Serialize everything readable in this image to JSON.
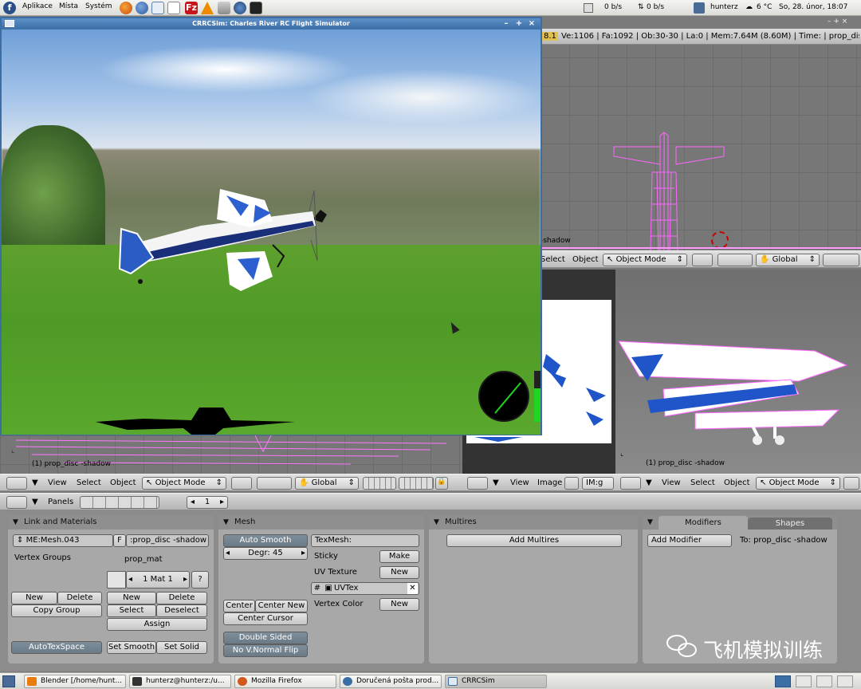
{
  "top_panel": {
    "menus": [
      "Aplikace",
      "Místa",
      "Systém"
    ],
    "net_down": "0 b/s",
    "net_up": "0 b/s",
    "user": "hunterz",
    "temperature": "6 °C",
    "clock": "So, 28. únor, 18:07"
  },
  "crrcsim": {
    "title": "CRRCSim: Charles River RC Flight Simulator",
    "wind_controls": [
      "–",
      "+",
      "×"
    ]
  },
  "viewport_top_right": {
    "version": "8.1",
    "stats": "Ve:1106 | Fa:1092 | Ob:30-30 | La:0  | Mem:7.64M (8.60M) | Time: | prop_disc",
    "label": "-shadow",
    "header": {
      "select": "Select",
      "object": "Object",
      "mode": "Object Mode",
      "orientation": "Global"
    }
  },
  "viewport_left": {
    "label": "(1) prop_disc -shadow",
    "header": {
      "view": "View",
      "select": "Select",
      "object": "Object",
      "mode": "Object Mode",
      "orientation": "Global"
    }
  },
  "image_editor": {
    "header": {
      "view": "View",
      "image": "Image",
      "field": "IM:g"
    }
  },
  "viewport_bottom_right": {
    "label": "(1) prop_disc -shadow",
    "header": {
      "view": "View",
      "select": "Select",
      "object": "Object",
      "mode": "Object Mode"
    }
  },
  "buttons_header": {
    "panels": "Panels",
    "frame": "1"
  },
  "link_materials": {
    "title": "Link and Materials",
    "mesh_name": "ME:Mesh.043",
    "f_button": "F",
    "object_name": ":prop_disc -shadow",
    "vertex_groups": "Vertex Groups",
    "material_name": "prop_mat",
    "mat_index": "1 Mat 1",
    "question": "?",
    "vg_new": "New",
    "vg_delete": "Delete",
    "copy_group": "Copy Group",
    "mat_new": "New",
    "mat_delete": "Delete",
    "select": "Select",
    "deselect": "Deselect",
    "assign": "Assign",
    "autotexspace": "AutoTexSpace",
    "set_smooth": "Set Smooth",
    "set_solid": "Set Solid"
  },
  "mesh": {
    "title": "Mesh",
    "auto_smooth": "Auto Smooth",
    "degr": "Degr: 45",
    "texmesh": "TexMesh:",
    "sticky": "Sticky",
    "make": "Make",
    "uv_texture": "UV Texture",
    "uv_new": "New",
    "uvtex": "UVTex",
    "vertex_color": "Vertex Color",
    "vc_new": "New",
    "center": "Center",
    "center_new": "Center New",
    "center_cursor": "Center Cursor",
    "double_sided": "Double Sided",
    "no_vnormal_flip": "No V.Normal Flip"
  },
  "multires": {
    "title": "Multires",
    "add": "Add Multires"
  },
  "modifiers": {
    "tab_modifiers": "Modifiers",
    "tab_shapes": "Shapes",
    "add_modifier": "Add Modifier",
    "to": "To: prop_disc -shadow"
  },
  "taskbar": {
    "items": [
      "Blender [/home/hunt...",
      "hunterz@hunterz:/u...",
      "Mozilla Firefox",
      "Doručená pošta prod...",
      "CRRCSim"
    ]
  },
  "watermark": "飞机模拟训练"
}
